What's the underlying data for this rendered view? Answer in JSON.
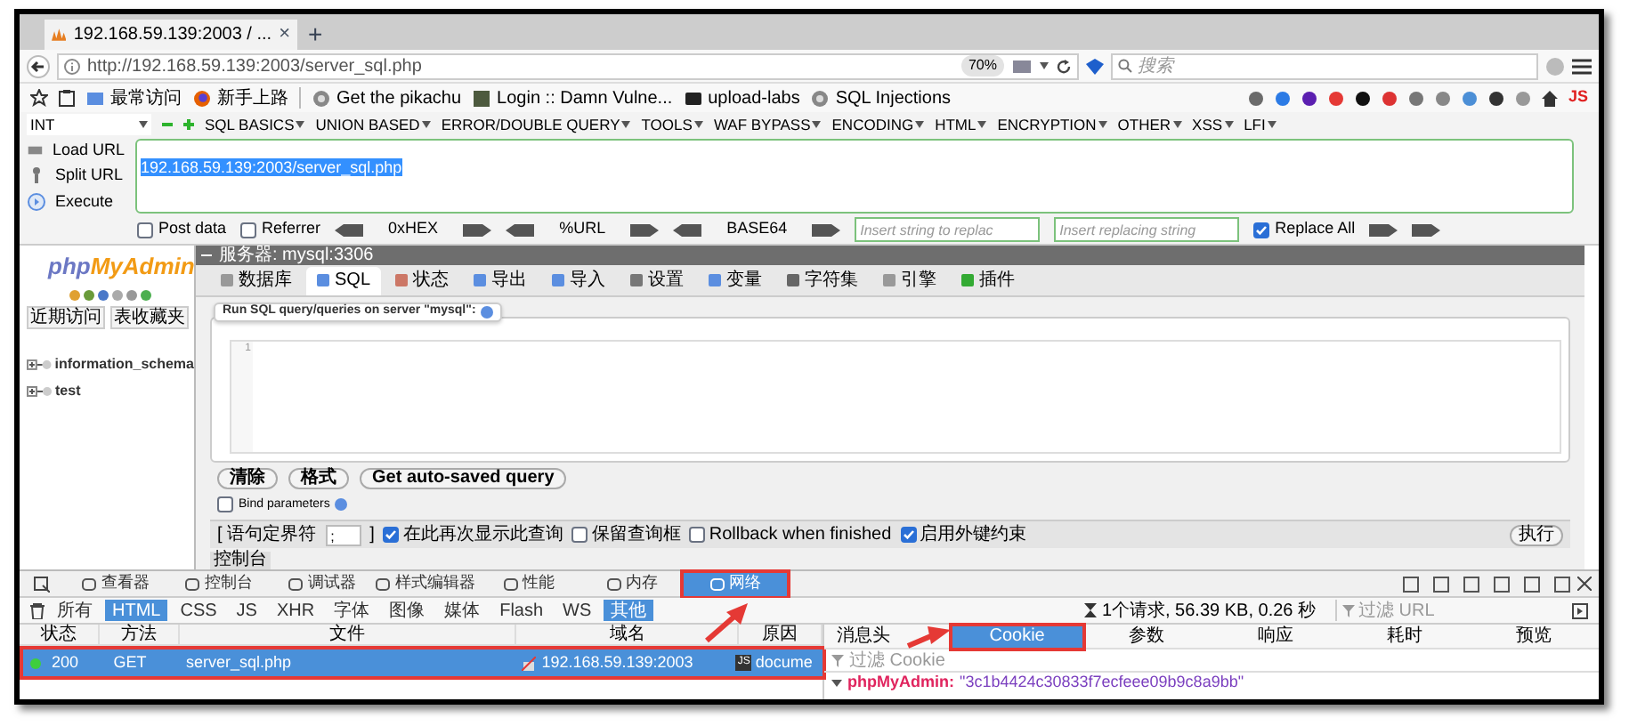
{
  "browser_tab": {
    "title": "192.168.59.139:2003 / ...",
    "close": "×",
    "new_tab": "+"
  },
  "address_bar": {
    "url": "http://192.168.59.139:2003/server_sql.php",
    "zoom": "70%",
    "search_placeholder": "搜索"
  },
  "bookmarks": [
    {
      "label": "最常访问",
      "kind": "folder"
    },
    {
      "label": "新手上路",
      "kind": "firefox"
    },
    {
      "label": "Get the pikachu",
      "kind": "globe"
    },
    {
      "label": "Login :: Damn Vulne...",
      "kind": "image"
    },
    {
      "label": "upload-labs",
      "kind": "folder-dark"
    },
    {
      "label": "SQL Injections",
      "kind": "globe"
    }
  ],
  "extension_badge": "JS",
  "hackbar": {
    "type_select": "INT",
    "menus": [
      "SQL BASICS",
      "UNION BASED",
      "ERROR/DOUBLE QUERY",
      "TOOLS",
      "WAF BYPASS",
      "ENCODING",
      "HTML",
      "ENCRYPTION",
      "OTHER",
      "XSS",
      "LFI"
    ],
    "actions": [
      "Load URL",
      "Split URL",
      "Execute"
    ],
    "url": "192.168.59.139:2003/server_sql.php",
    "options": [
      {
        "kind": "checkbox",
        "label": "Post data",
        "checked": false
      },
      {
        "kind": "checkbox",
        "label": "Referrer",
        "checked": false
      },
      {
        "kind": "encoder",
        "label": "0xHEX"
      },
      {
        "kind": "encoder",
        "label": "%URL"
      },
      {
        "kind": "encoder",
        "label": "BASE64"
      },
      {
        "kind": "input",
        "placeholder": "Insert string to replac"
      },
      {
        "kind": "input",
        "placeholder": "Insert replacing string"
      },
      {
        "kind": "checkbox",
        "label": "Replace All",
        "checked": true
      }
    ]
  },
  "phpmyadmin": {
    "logo_parts": [
      "php",
      "MyAdmin"
    ],
    "sidebar_tabs": [
      "近期访问",
      "表收藏夹"
    ],
    "databases": [
      {
        "name": "information_schema"
      },
      {
        "name": "test"
      }
    ],
    "breadcrumb": "服务器: mysql:3306",
    "tabs": [
      {
        "label": "数据库",
        "selected": false
      },
      {
        "label": "SQL",
        "selected": true
      },
      {
        "label": "状态",
        "selected": false
      },
      {
        "label": "导出",
        "selected": false
      },
      {
        "label": "导入",
        "selected": false
      },
      {
        "label": "设置",
        "selected": false
      },
      {
        "label": "变量",
        "selected": false
      },
      {
        "label": "字符集",
        "selected": false
      },
      {
        "label": "引擎",
        "selected": false
      },
      {
        "label": "插件",
        "selected": false
      }
    ],
    "query_legend": "Run SQL query/queries on server \"mysql\":",
    "line_number": "1",
    "buttons": [
      "清除",
      "格式",
      "Get auto-saved query"
    ],
    "bind_parameters": {
      "label": "Bind parameters",
      "checked": false
    },
    "delimiter_label": "[ 语句定界符",
    "delimiter": ";",
    "delimiter_end": "]",
    "options": [
      {
        "label": "在此再次显示此查询",
        "checked": true
      },
      {
        "label": "保留查询框",
        "checked": false
      },
      {
        "label": "Rollback when finished",
        "checked": false
      },
      {
        "label": "启用外键约束",
        "checked": true
      }
    ],
    "go_button": "执行",
    "console_tab": "控制台"
  },
  "devtools": {
    "tabs": [
      {
        "label": "查看器",
        "selected": false,
        "marked": false
      },
      {
        "label": "控制台",
        "selected": false,
        "marked": false
      },
      {
        "label": "调试器",
        "selected": false,
        "marked": false
      },
      {
        "label": "样式编辑器",
        "selected": false,
        "marked": false
      },
      {
        "label": "性能",
        "selected": false,
        "marked": false
      },
      {
        "label": "内存",
        "selected": false,
        "marked": false
      },
      {
        "label": "网络",
        "selected": true,
        "marked": true
      }
    ],
    "filters": [
      {
        "label": "所有",
        "selected": false
      },
      {
        "label": "HTML",
        "selected": true
      },
      {
        "label": "CSS",
        "selected": false
      },
      {
        "label": "JS",
        "selected": false
      },
      {
        "label": "XHR",
        "selected": false
      },
      {
        "label": "字体",
        "selected": false
      },
      {
        "label": "图像",
        "selected": false
      },
      {
        "label": "媒体",
        "selected": false
      },
      {
        "label": "Flash",
        "selected": false
      },
      {
        "label": "WS",
        "selected": false
      },
      {
        "label": "其他",
        "selected": true
      }
    ],
    "summary": "1个请求, 56.39 KB, 0.26 秒",
    "filter_placeholder": "过滤 URL",
    "columns": [
      "状态",
      "方法",
      "文件",
      "域名",
      "原因"
    ],
    "rows": [
      {
        "status": "200",
        "method": "GET",
        "file": "server_sql.php",
        "domain": "192.168.59.139:2003",
        "cause_icon": "JS",
        "cause": "docume",
        "selected": true,
        "marked": true
      }
    ],
    "detail_tabs": [
      {
        "label": "消息头",
        "selected": false,
        "marked": false
      },
      {
        "label": "Cookie",
        "selected": true,
        "marked": true
      },
      {
        "label": "参数",
        "selected": false,
        "marked": false
      },
      {
        "label": "响应",
        "selected": false,
        "marked": false
      },
      {
        "label": "耗时",
        "selected": false,
        "marked": false
      },
      {
        "label": "预览",
        "selected": false,
        "marked": false
      }
    ],
    "cookie_filter_placeholder": "过滤 Cookie",
    "cookies": [
      {
        "name": "phpMyAdmin:",
        "value": "\"3c1b4424c30833f7ecfeee09b9c8a9bb\""
      }
    ]
  }
}
